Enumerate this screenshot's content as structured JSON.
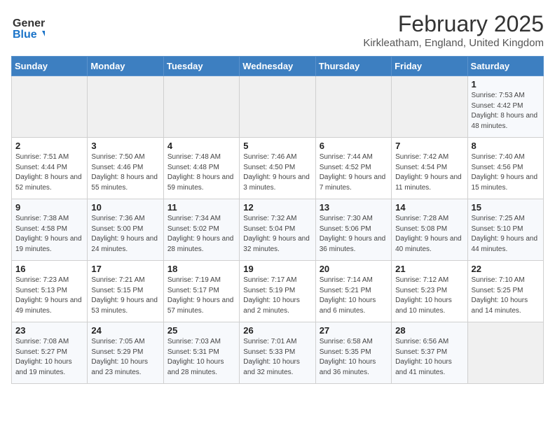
{
  "app": {
    "logo_general": "General",
    "logo_blue": "Blue"
  },
  "header": {
    "month": "February 2025",
    "location": "Kirkleatham, England, United Kingdom"
  },
  "days_of_week": [
    "Sunday",
    "Monday",
    "Tuesday",
    "Wednesday",
    "Thursday",
    "Friday",
    "Saturday"
  ],
  "weeks": [
    [
      {
        "day": "",
        "info": ""
      },
      {
        "day": "",
        "info": ""
      },
      {
        "day": "",
        "info": ""
      },
      {
        "day": "",
        "info": ""
      },
      {
        "day": "",
        "info": ""
      },
      {
        "day": "",
        "info": ""
      },
      {
        "day": "1",
        "info": "Sunrise: 7:53 AM\nSunset: 4:42 PM\nDaylight: 8 hours and 48 minutes."
      }
    ],
    [
      {
        "day": "2",
        "info": "Sunrise: 7:51 AM\nSunset: 4:44 PM\nDaylight: 8 hours and 52 minutes."
      },
      {
        "day": "3",
        "info": "Sunrise: 7:50 AM\nSunset: 4:46 PM\nDaylight: 8 hours and 55 minutes."
      },
      {
        "day": "4",
        "info": "Sunrise: 7:48 AM\nSunset: 4:48 PM\nDaylight: 8 hours and 59 minutes."
      },
      {
        "day": "5",
        "info": "Sunrise: 7:46 AM\nSunset: 4:50 PM\nDaylight: 9 hours and 3 minutes."
      },
      {
        "day": "6",
        "info": "Sunrise: 7:44 AM\nSunset: 4:52 PM\nDaylight: 9 hours and 7 minutes."
      },
      {
        "day": "7",
        "info": "Sunrise: 7:42 AM\nSunset: 4:54 PM\nDaylight: 9 hours and 11 minutes."
      },
      {
        "day": "8",
        "info": "Sunrise: 7:40 AM\nSunset: 4:56 PM\nDaylight: 9 hours and 15 minutes."
      }
    ],
    [
      {
        "day": "9",
        "info": "Sunrise: 7:38 AM\nSunset: 4:58 PM\nDaylight: 9 hours and 19 minutes."
      },
      {
        "day": "10",
        "info": "Sunrise: 7:36 AM\nSunset: 5:00 PM\nDaylight: 9 hours and 24 minutes."
      },
      {
        "day": "11",
        "info": "Sunrise: 7:34 AM\nSunset: 5:02 PM\nDaylight: 9 hours and 28 minutes."
      },
      {
        "day": "12",
        "info": "Sunrise: 7:32 AM\nSunset: 5:04 PM\nDaylight: 9 hours and 32 minutes."
      },
      {
        "day": "13",
        "info": "Sunrise: 7:30 AM\nSunset: 5:06 PM\nDaylight: 9 hours and 36 minutes."
      },
      {
        "day": "14",
        "info": "Sunrise: 7:28 AM\nSunset: 5:08 PM\nDaylight: 9 hours and 40 minutes."
      },
      {
        "day": "15",
        "info": "Sunrise: 7:25 AM\nSunset: 5:10 PM\nDaylight: 9 hours and 44 minutes."
      }
    ],
    [
      {
        "day": "16",
        "info": "Sunrise: 7:23 AM\nSunset: 5:13 PM\nDaylight: 9 hours and 49 minutes."
      },
      {
        "day": "17",
        "info": "Sunrise: 7:21 AM\nSunset: 5:15 PM\nDaylight: 9 hours and 53 minutes."
      },
      {
        "day": "18",
        "info": "Sunrise: 7:19 AM\nSunset: 5:17 PM\nDaylight: 9 hours and 57 minutes."
      },
      {
        "day": "19",
        "info": "Sunrise: 7:17 AM\nSunset: 5:19 PM\nDaylight: 10 hours and 2 minutes."
      },
      {
        "day": "20",
        "info": "Sunrise: 7:14 AM\nSunset: 5:21 PM\nDaylight: 10 hours and 6 minutes."
      },
      {
        "day": "21",
        "info": "Sunrise: 7:12 AM\nSunset: 5:23 PM\nDaylight: 10 hours and 10 minutes."
      },
      {
        "day": "22",
        "info": "Sunrise: 7:10 AM\nSunset: 5:25 PM\nDaylight: 10 hours and 14 minutes."
      }
    ],
    [
      {
        "day": "23",
        "info": "Sunrise: 7:08 AM\nSunset: 5:27 PM\nDaylight: 10 hours and 19 minutes."
      },
      {
        "day": "24",
        "info": "Sunrise: 7:05 AM\nSunset: 5:29 PM\nDaylight: 10 hours and 23 minutes."
      },
      {
        "day": "25",
        "info": "Sunrise: 7:03 AM\nSunset: 5:31 PM\nDaylight: 10 hours and 28 minutes."
      },
      {
        "day": "26",
        "info": "Sunrise: 7:01 AM\nSunset: 5:33 PM\nDaylight: 10 hours and 32 minutes."
      },
      {
        "day": "27",
        "info": "Sunrise: 6:58 AM\nSunset: 5:35 PM\nDaylight: 10 hours and 36 minutes."
      },
      {
        "day": "28",
        "info": "Sunrise: 6:56 AM\nSunset: 5:37 PM\nDaylight: 10 hours and 41 minutes."
      },
      {
        "day": "",
        "info": ""
      }
    ]
  ]
}
